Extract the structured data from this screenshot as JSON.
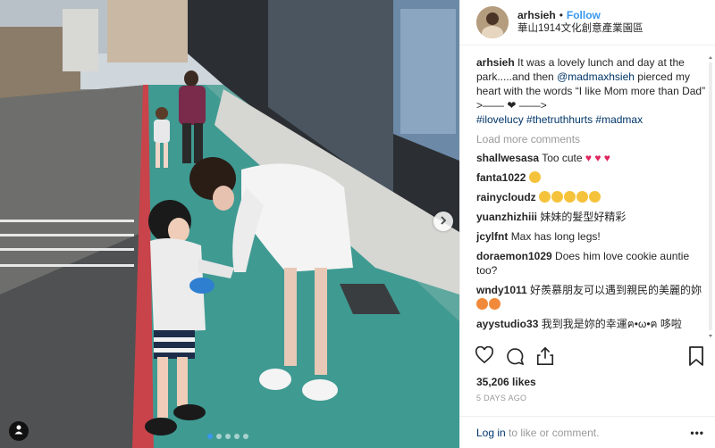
{
  "post": {
    "username": "arhsieh",
    "follow_label": "Follow",
    "location": "華山1914文化創意產業園區",
    "caption_parts": {
      "user": "arhsieh",
      "text1": " It was a lovely lunch and day at the park.....and then ",
      "mention": "@madmaxhsieh",
      "text2": " pierced my heart with the words “I like Mom more than Dad”",
      "arrow": ">—— ❤ ——>",
      "hashtags": "#ilovelucy #thetruthhurts #madmax"
    },
    "load_more_label": "Load more comments",
    "comments": [
      {
        "user": "shallwesasa",
        "text": "Too cute ",
        "extra": "♥ ♥ ♥"
      },
      {
        "user": "fanta1022",
        "text": " ",
        "extra": ""
      },
      {
        "user": "rainycloudz",
        "text": " ",
        "extra": ""
      },
      {
        "user": "yuanzhizhiii",
        "text": "妹妹的髮型好精彩",
        "extra": ""
      },
      {
        "user": "jcylfnt",
        "text": "Max has long legs!",
        "extra": ""
      },
      {
        "user": "doraemon1029",
        "text": "Does him love cookie auntie too?",
        "extra": ""
      },
      {
        "user": "wndy1011",
        "text": "好羨慕朋友可以遇到親民的美麗的妳 ",
        "extra": ""
      },
      {
        "user": "ayystudio33",
        "text": "我到我是妳的幸運ฅ•ω•ฅ 哆啦",
        "extra": ""
      }
    ],
    "likes": "35,206 likes",
    "timestamp": "5 DAYS AGO",
    "footer": {
      "login_label": "Log in",
      "rest": " to like or comment.",
      "more": "•••"
    }
  },
  "icons": {
    "like": "heart-outline-icon",
    "comment": "comment-bubble-icon",
    "share": "share-icon",
    "save": "bookmark-icon",
    "next": "chevron-right-icon",
    "user_tag": "person-icon"
  },
  "colors": {
    "accent": "#3897f0",
    "link": "#003569",
    "muted": "#999999",
    "heart": "#e0245e"
  }
}
